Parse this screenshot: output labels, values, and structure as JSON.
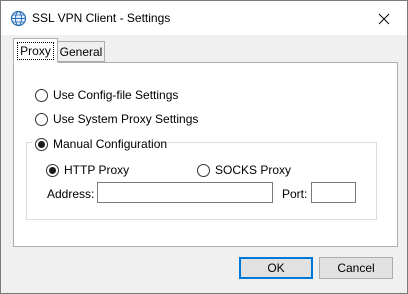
{
  "window": {
    "title": "SSL VPN Client - Settings"
  },
  "tabs": [
    {
      "label": "Proxy",
      "active": true
    },
    {
      "label": "General",
      "active": false
    }
  ],
  "proxy": {
    "options": [
      {
        "label": "Use Config-file Settings",
        "checked": false
      },
      {
        "label": "Use System Proxy Settings",
        "checked": false
      },
      {
        "label": "Manual Configuration",
        "checked": true
      }
    ],
    "manual": {
      "protocols": [
        {
          "label": "HTTP Proxy",
          "checked": true
        },
        {
          "label": "SOCKS Proxy",
          "checked": false
        }
      ],
      "address_label": "Address:",
      "address_value": "",
      "port_label": "Port:",
      "port_value": ""
    }
  },
  "buttons": {
    "ok_label": "OK",
    "cancel_label": "Cancel"
  },
  "colors": {
    "accent": "#0078d7",
    "window_bg": "#f0f0f0",
    "panel_bg": "#ffffff"
  },
  "icons": {
    "app": "globe-network-icon",
    "close": "close-icon"
  }
}
